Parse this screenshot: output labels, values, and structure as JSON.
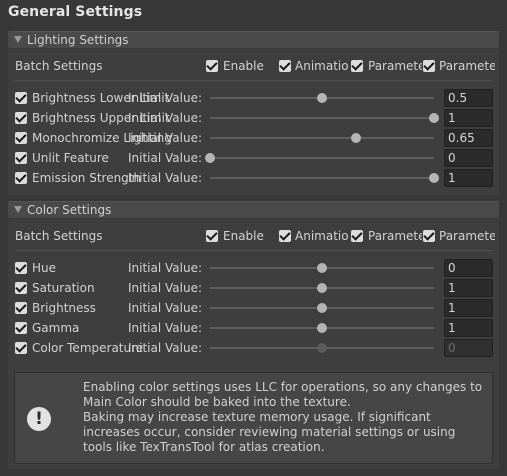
{
  "title": "General Settings",
  "lighting": {
    "header": "Lighting Settings",
    "batch": {
      "label": "Batch Settings",
      "enable": "Enable",
      "animation": "Animation",
      "parameter1": "Parameter",
      "parameter2": "Parameter"
    },
    "rows": [
      {
        "label": "Brightness Lower Limit",
        "initial": "Initial Value:",
        "value": "0.5",
        "fraction": 0.5
      },
      {
        "label": "Brightness Upper Limit",
        "initial": "Initial Value:",
        "value": "1",
        "fraction": 1.0
      },
      {
        "label": "Monochromize Lighting",
        "initial": "Initial Value:",
        "value": "0.65",
        "fraction": 0.65
      },
      {
        "label": "Unlit Feature",
        "initial": "Initial Value:",
        "value": "0",
        "fraction": 0.0
      },
      {
        "label": "Emission Strength",
        "initial": "Initial Value:",
        "value": "1",
        "fraction": 1.0
      }
    ]
  },
  "color": {
    "header": "Color Settings",
    "batch": {
      "label": "Batch Settings",
      "enable": "Enable",
      "animation": "Animation",
      "parameter1": "Parameter",
      "parameter2": "Parameter"
    },
    "rows": [
      {
        "label": "Hue",
        "initial": "Initial Value:",
        "value": "0",
        "fraction": 0.5
      },
      {
        "label": "Saturation",
        "initial": "Initial Value:",
        "value": "1",
        "fraction": 0.5
      },
      {
        "label": "Brightness",
        "initial": "Initial Value:",
        "value": "1",
        "fraction": 0.5
      },
      {
        "label": "Gamma",
        "initial": "Initial Value:",
        "value": "1",
        "fraction": 0.5
      },
      {
        "label": "Color Temperature",
        "initial": "Initial Value:",
        "value": "0",
        "fraction": 0.5
      }
    ]
  },
  "help": {
    "icon": "!",
    "text": "Enabling color settings uses LLC for operations, so any changes to Main Color should be baked into the texture.\nBaking may increase texture memory usage. If significant increases occur, consider reviewing material settings or using tools like TexTransTool for atlas creation."
  }
}
